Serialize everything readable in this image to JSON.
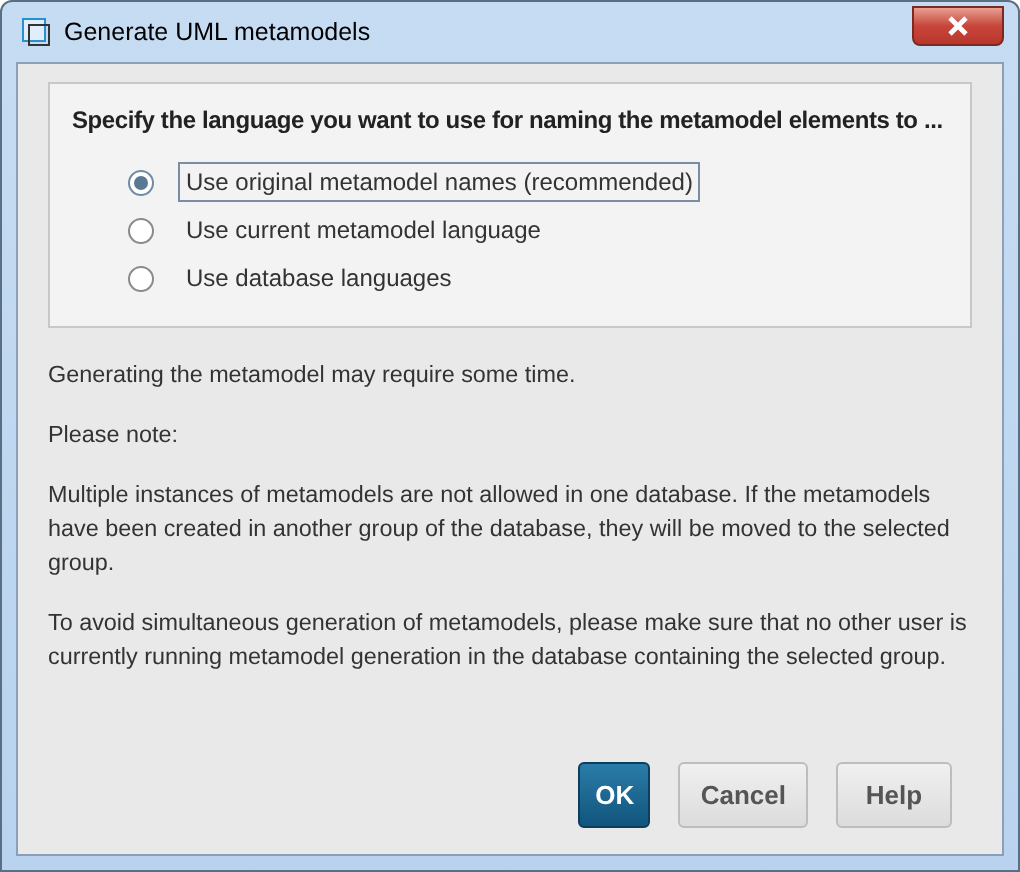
{
  "window": {
    "title": "Generate UML metamodels"
  },
  "group": {
    "heading": "Specify the language you want to use for naming the metamodel elements to ...",
    "options": [
      {
        "label": "Use original metamodel names (recommended)",
        "selected": true
      },
      {
        "label": "Use current metamodel language",
        "selected": false
      },
      {
        "label": "Use database languages",
        "selected": false
      }
    ]
  },
  "paragraphs": [
    "Generating the metamodel may require some time.",
    "Please note:",
    "Multiple instances of metamodels are not allowed in one database. If the metamodels have been created in another group of the database, they will be moved to the selected group.",
    "To avoid simultaneous generation of metamodels, please make sure that no other user is currently running metamodel generation in the database containing the selected group."
  ],
  "buttons": [
    {
      "label": "OK",
      "kind": "primary"
    },
    {
      "label": "Cancel",
      "kind": "normal"
    },
    {
      "label": "Help",
      "kind": "normal"
    }
  ]
}
